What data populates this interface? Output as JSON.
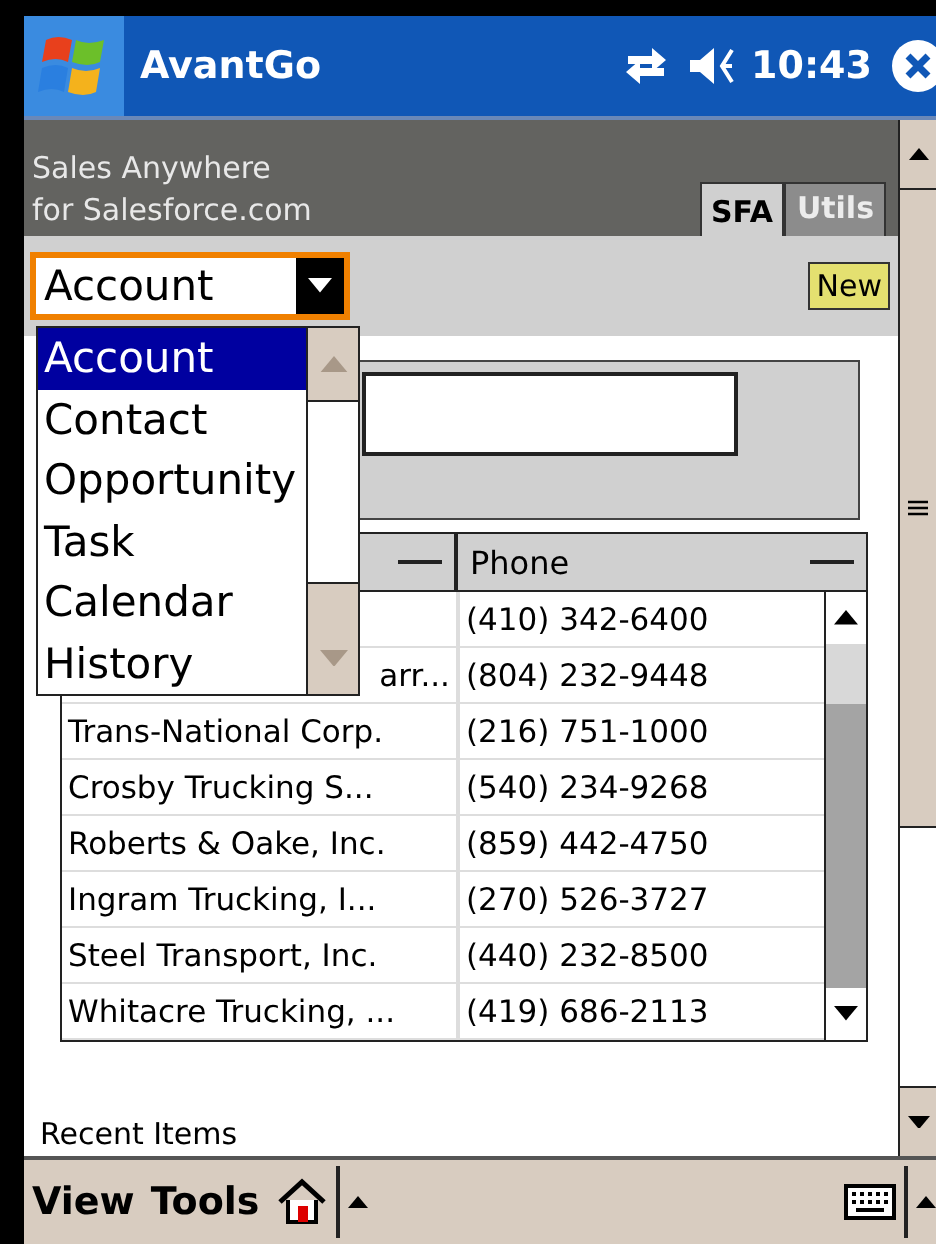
{
  "title_bar": {
    "app": "AvantGo",
    "time": "10:43"
  },
  "header": {
    "lines": [
      "Sales Anywhere",
      "for Salesforce.com"
    ],
    "tabs": [
      {
        "label": "SFA",
        "selected": true
      },
      {
        "label": "Utils",
        "selected": false
      }
    ]
  },
  "toolbar": {
    "dropdown": {
      "value": "Account",
      "expanded": true
    },
    "new_button": "New"
  },
  "dropdown_list": [
    {
      "label": "Account",
      "selected": true
    },
    {
      "label": "Contact",
      "selected": false
    },
    {
      "label": "Opportunity",
      "selected": false
    },
    {
      "label": "Task",
      "selected": false
    },
    {
      "label": "Calendar",
      "selected": false
    },
    {
      "label": "History",
      "selected": false
    }
  ],
  "table": {
    "phone_column": "Phone",
    "rows": [
      {
        "phone": "(410) 342-6400"
      },
      {
        "name": "arr...",
        "phone": "(804) 232-9448"
      },
      {
        "name": "Trans-National Corp.",
        "phone": "(216) 751-1000"
      },
      {
        "name": "Crosby Trucking S...",
        "phone": "(540) 234-9268"
      },
      {
        "name": "Roberts & Oake, Inc.",
        "phone": "(859) 442-4750"
      },
      {
        "name": "Ingram Trucking, I...",
        "phone": "(270) 526-3727"
      },
      {
        "name": "Steel Transport, Inc.",
        "phone": "(440) 232-8500"
      },
      {
        "name": "Whitacre Trucking, ...",
        "phone": "(419) 686-2113"
      }
    ]
  },
  "recent_items": "Recent Items",
  "menu_bar": [
    "View",
    "Tools"
  ]
}
